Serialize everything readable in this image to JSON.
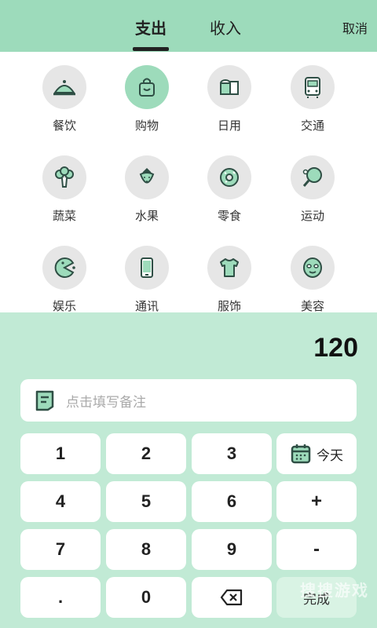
{
  "header": {
    "tabs": [
      {
        "label": "支出",
        "active": true
      },
      {
        "label": "收入",
        "active": false
      }
    ],
    "cancel_label": "取消"
  },
  "categories": [
    {
      "label": "餐饮",
      "icon": "food-cloche-icon"
    },
    {
      "label": "购物",
      "icon": "shopping-bag-icon",
      "selected": true
    },
    {
      "label": "日用",
      "icon": "toilet-paper-icon"
    },
    {
      "label": "交通",
      "icon": "bus-icon"
    },
    {
      "label": "蔬菜",
      "icon": "broccoli-icon"
    },
    {
      "label": "水果",
      "icon": "strawberry-icon"
    },
    {
      "label": "零食",
      "icon": "donut-icon"
    },
    {
      "label": "运动",
      "icon": "ping-pong-icon"
    },
    {
      "label": "娱乐",
      "icon": "pacman-icon"
    },
    {
      "label": "通讯",
      "icon": "phone-icon"
    },
    {
      "label": "服饰",
      "icon": "tshirt-icon"
    },
    {
      "label": "美容",
      "icon": "face-mask-icon"
    }
  ],
  "amount": "120",
  "note": {
    "placeholder": "点击填写备注"
  },
  "keypad": {
    "k1": "1",
    "k2": "2",
    "k3": "3",
    "date": "今天",
    "k4": "4",
    "k5": "5",
    "k6": "6",
    "plus": "+",
    "k7": "7",
    "k8": "8",
    "k9": "9",
    "minus": "-",
    "dot": ".",
    "k0": "0",
    "done": "完成"
  },
  "watermark": "搜搜游戏",
  "colors": {
    "header": "#9ddbbb",
    "keypad_bg": "#c1ead5",
    "selected": "#9ddbbb",
    "icon_dark": "#2f4f45"
  }
}
